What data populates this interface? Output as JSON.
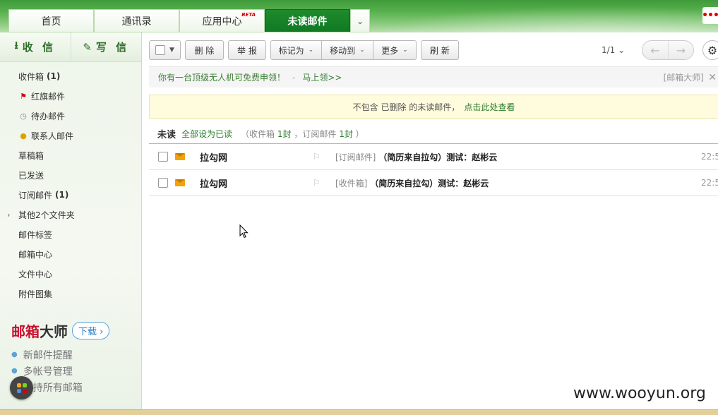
{
  "header": {
    "tabs": [
      {
        "label": "首页"
      },
      {
        "label": "通讯录"
      },
      {
        "label": "应用中心",
        "badge": "BETA"
      },
      {
        "label": "未读邮件",
        "active": true
      }
    ],
    "more_icon": "ellipsis-icon"
  },
  "sidebar": {
    "receive_label": "收 信",
    "compose_label": "写 信",
    "folders": [
      {
        "label": "收件箱",
        "count": "(1)"
      },
      {
        "label": "红旗邮件",
        "icon": "red-flag-icon"
      },
      {
        "label": "待办邮件",
        "icon": "clock-icon"
      },
      {
        "label": "联系人邮件",
        "icon": "person-icon"
      },
      {
        "label": "草稿箱"
      },
      {
        "label": "已发送"
      },
      {
        "label": "订阅邮件",
        "count": "(1)"
      },
      {
        "label": "其他2个文件夹",
        "expandable": true
      },
      {
        "label": "邮件标签"
      },
      {
        "label": "邮箱中心"
      },
      {
        "label": "文件中心"
      },
      {
        "label": "附件图集"
      }
    ],
    "master": {
      "logo_a": "邮箱",
      "logo_b": "大师",
      "download_label": "下载",
      "features": [
        "新邮件提醒",
        "多帐号管理",
        "支持所有邮箱"
      ]
    }
  },
  "toolbar": {
    "delete_label": "删 除",
    "report_label": "举 报",
    "mark_label": "标记为",
    "move_label": "移动到",
    "more_label": "更多",
    "refresh_label": "刷 新",
    "page_label": "1/1"
  },
  "promo": {
    "text": "你有一台顶级无人机可免费申领！",
    "separator": "-",
    "link": "马上领>>",
    "source": "[邮箱大师]"
  },
  "notice": {
    "text": "不包含 已删除 的未读邮件，",
    "link": "点击此处查看"
  },
  "list": {
    "title": "未读",
    "mark_all": "全部设为已读",
    "info_prefix": "（收件箱",
    "info_inbox": "1封",
    "info_mid": "，订阅邮件",
    "info_sub": "1封",
    "info_suffix": "）",
    "rows": [
      {
        "sender": "拉勾网",
        "tag": "[订阅邮件]",
        "subject": "（简历来自拉勾）测试：赵彬云",
        "time": "22:5"
      },
      {
        "sender": "拉勾网",
        "tag": "[收件箱]",
        "subject": "（简历来自拉勾）测试：赵彬云",
        "time": "22:5"
      }
    ]
  },
  "watermark": "www.wooyun.org",
  "colors": {
    "brand_green": "#0f7a22",
    "link_green": "#2a7a2a",
    "notice_bg": "#fffbdd",
    "flag_red": "#c8102e"
  }
}
